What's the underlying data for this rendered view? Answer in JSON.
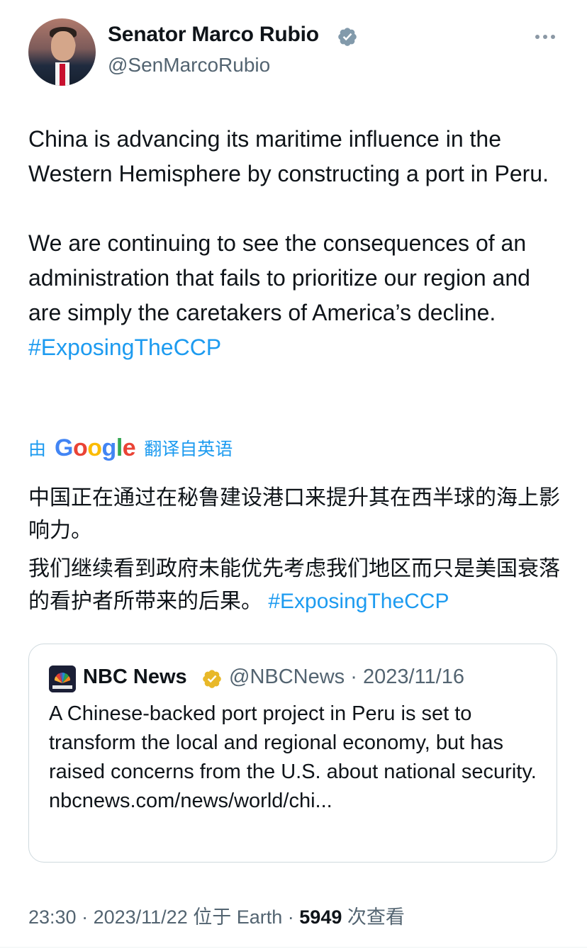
{
  "author": {
    "display_name": "Senator Marco Rubio",
    "handle": "@SenMarcoRubio",
    "verified_color": "#829aab"
  },
  "tweet": {
    "paragraph1": "China is advancing its maritime influence in the Western Hemisphere by constructing a port in Peru.",
    "paragraph2": "We are continuing to see the consequences of an administration that fails to prioritize our region and are simply the caretakers of America’s decline.",
    "hashtag": "#ExposingTheCCP"
  },
  "translation": {
    "by_label": "由",
    "provider": "Google",
    "from_label": "翻译自英语",
    "paragraph1": "中国正在通过在秘鲁建设港口来提升其在西半球的海上影响力。",
    "paragraph2": "我们继续看到政府未能优先考虑我们地区而只是美国衰落的看护者所带来的后果。",
    "hashtag": "#ExposingTheCCP"
  },
  "quote": {
    "name": "NBC News",
    "handle": "@NBCNews",
    "date": "2023/11/16",
    "text": "A Chinese-backed port project in Peru is set to transform the local and regional economy, but has raised concerns from the U.S. about national security.  nbcnews.com/news/world/chi...",
    "badge_color": "#e8b829"
  },
  "footer": {
    "time": "23:30",
    "date": "2023/11/22",
    "location": "位于 Earth",
    "views_count": "5949",
    "views_label": "次查看"
  },
  "colors": {
    "link": "#1d9bf0",
    "muted": "#536471",
    "text": "#0f1419"
  },
  "icons": {
    "more": "more-horizontal-icon",
    "verified": "verified-badge-icon"
  }
}
